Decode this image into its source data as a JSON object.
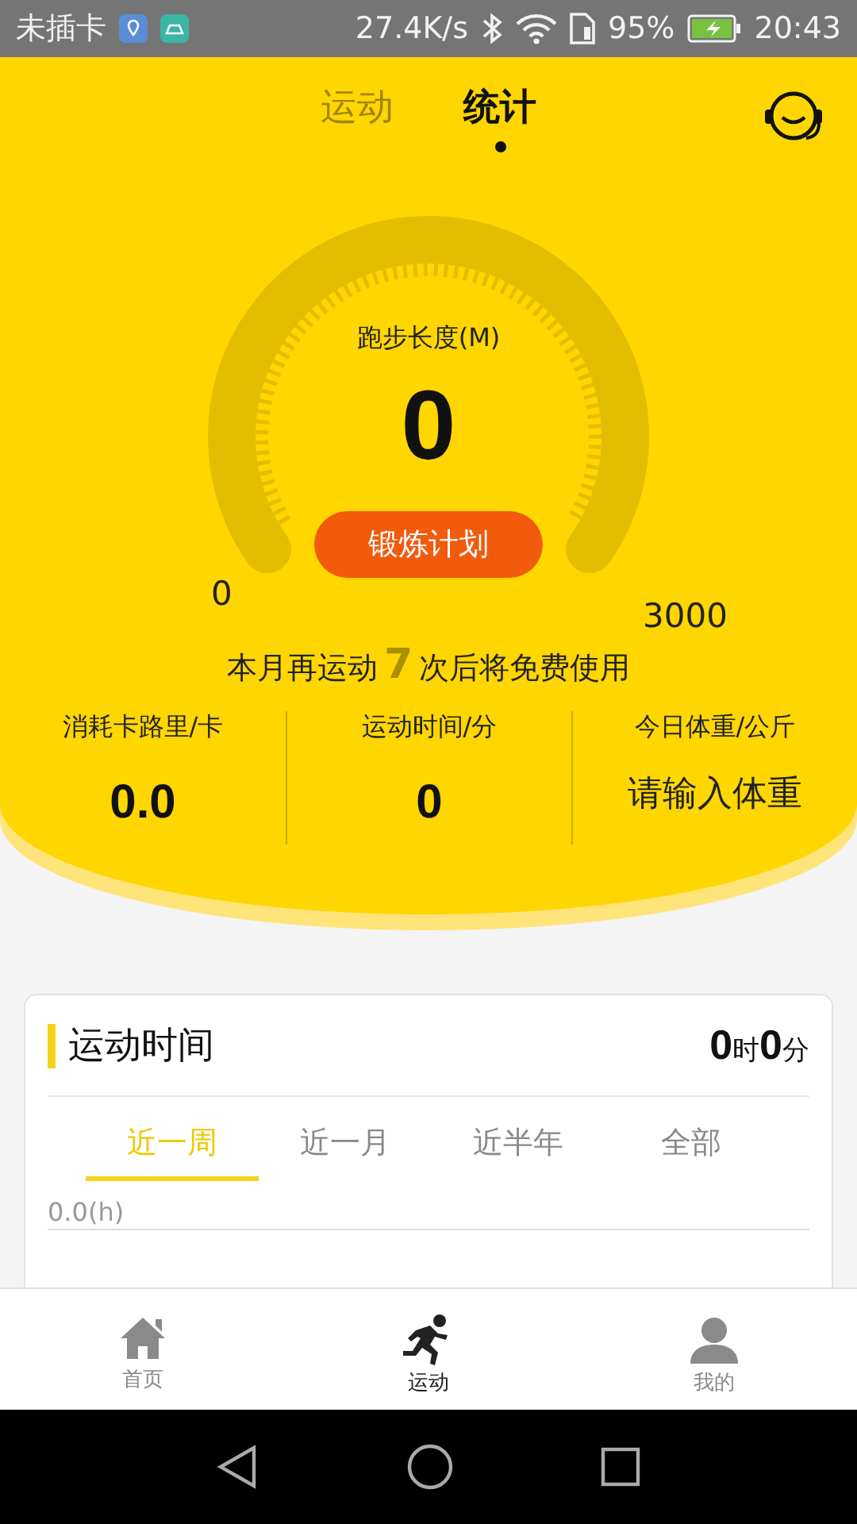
{
  "status_bar": {
    "carrier": "未插卡",
    "speed": "27.4K/s",
    "battery": "95%",
    "time": "20:43"
  },
  "top_tabs": [
    {
      "label": "运动",
      "selected": false
    },
    {
      "label": "统计",
      "selected": true
    }
  ],
  "gauge": {
    "title": "跑步长度(M)",
    "value": "0",
    "min": "0",
    "max": "3000",
    "button": "锻炼计划"
  },
  "notice": {
    "prefix": "本月再运动",
    "count": "7",
    "suffix": "次后将免费使用"
  },
  "stats": [
    {
      "label": "消耗卡路里/卡",
      "value": "0.0",
      "kind": "number"
    },
    {
      "label": "运动时间/分",
      "value": "0",
      "kind": "number"
    },
    {
      "label": "今日体重/公斤",
      "value": "请输入体重",
      "kind": "input"
    }
  ],
  "card": {
    "title": "运动时间",
    "hours": "0",
    "hours_unit": "时",
    "minutes": "0",
    "minutes_unit": "分",
    "periods": [
      {
        "label": "近一周",
        "selected": true
      },
      {
        "label": "近一月",
        "selected": false
      },
      {
        "label": "近半年",
        "selected": false
      },
      {
        "label": "全部",
        "selected": false
      }
    ],
    "axis_label": "0.0(h)"
  },
  "bottom_nav": [
    {
      "label": "首页",
      "kind": "home",
      "selected": false
    },
    {
      "label": "运动",
      "kind": "run",
      "selected": true
    },
    {
      "label": "我的",
      "kind": "user",
      "selected": false
    }
  ]
}
